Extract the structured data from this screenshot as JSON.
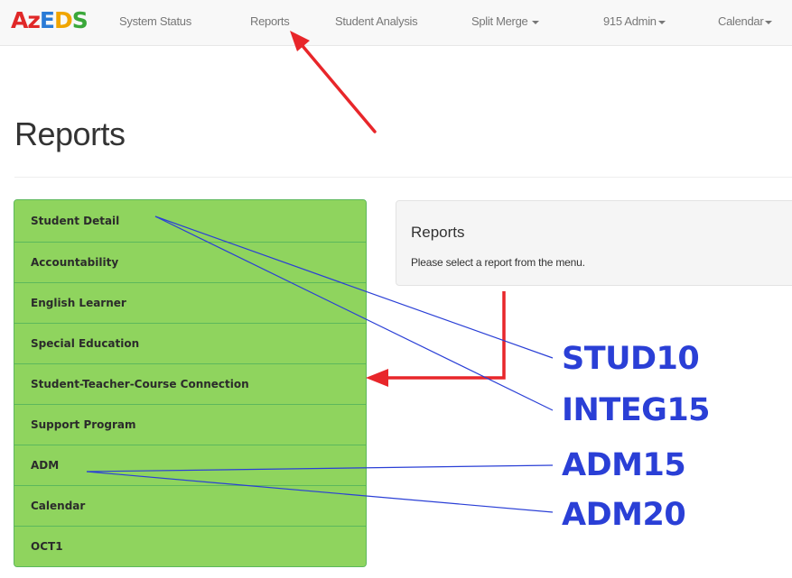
{
  "navbar": {
    "brand": {
      "part1": "Az",
      "part2": "E",
      "part3": "D",
      "part4": "S"
    },
    "items": [
      {
        "label": "System Status"
      },
      {
        "label": "Reports"
      },
      {
        "label": "Student Analysis"
      },
      {
        "label": "Split Merge"
      },
      {
        "label": "915 Admin"
      },
      {
        "label": "Calendar"
      }
    ]
  },
  "page": {
    "title": "Reports"
  },
  "menu": {
    "items": [
      {
        "label": "Student Detail"
      },
      {
        "label": "Accountability"
      },
      {
        "label": "English Learner"
      },
      {
        "label": "Special Education"
      },
      {
        "label": "Student-Teacher-Course Connection"
      },
      {
        "label": "Support Program"
      },
      {
        "label": "ADM"
      },
      {
        "label": "Calendar"
      },
      {
        "label": "OCT1"
      }
    ]
  },
  "panel": {
    "title": "Reports",
    "text": "Please select a report from the menu."
  },
  "annotations": {
    "labels": [
      "STUD10",
      "INTEG15",
      "ADM15",
      "ADM20"
    ]
  },
  "colors": {
    "menu_green": "#8fd45e",
    "menu_border": "#5cb85c",
    "annotation_blue": "#2a3fd6",
    "arrow_red": "#e8262a"
  }
}
